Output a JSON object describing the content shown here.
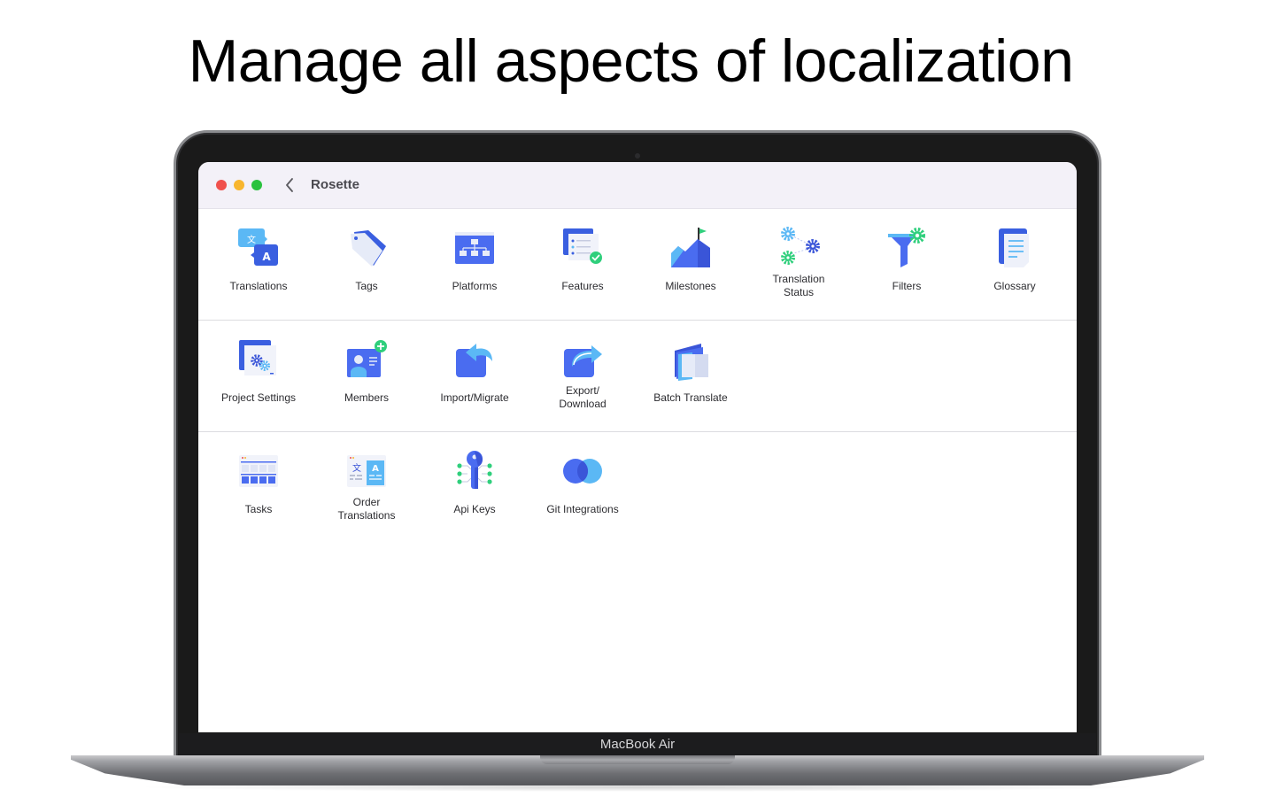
{
  "headline": "Manage all aspects of localization",
  "device": {
    "label": "MacBook Air"
  },
  "window": {
    "title": "Rosette",
    "colors": {
      "accent_blue": "#4a6cf0",
      "light_blue": "#5bbcf7",
      "green": "#2fcf7c"
    }
  },
  "rows": [
    {
      "items": [
        {
          "label": "Translations",
          "icon": "translations-icon"
        },
        {
          "label": "Tags",
          "icon": "tag-icon"
        },
        {
          "label": "Platforms",
          "icon": "platforms-icon"
        },
        {
          "label": "Features",
          "icon": "features-icon"
        },
        {
          "label": "Milestones",
          "icon": "milestone-flag-icon"
        },
        {
          "label_lines": [
            "Translation",
            "Status"
          ],
          "icon": "gears-status-icon"
        },
        {
          "label": "Filters",
          "icon": "filter-icon"
        },
        {
          "label": "Glossary",
          "icon": "glossary-icon"
        }
      ]
    },
    {
      "items": [
        {
          "label": "Project Settings",
          "icon": "project-settings-icon"
        },
        {
          "label": "Members",
          "icon": "members-icon"
        },
        {
          "label": "Import/Migrate",
          "icon": "import-icon"
        },
        {
          "label_lines": [
            "Export/",
            "Download"
          ],
          "icon": "export-icon"
        },
        {
          "label": "Batch Translate",
          "icon": "batch-translate-icon"
        }
      ]
    },
    {
      "items": [
        {
          "label": "Tasks",
          "icon": "tasks-icon"
        },
        {
          "label_lines": [
            "Order",
            "Translations"
          ],
          "icon": "order-translations-icon"
        },
        {
          "label": "Api Keys",
          "icon": "api-key-icon"
        },
        {
          "label": "Git Integrations",
          "icon": "git-integrations-icon"
        }
      ]
    }
  ]
}
